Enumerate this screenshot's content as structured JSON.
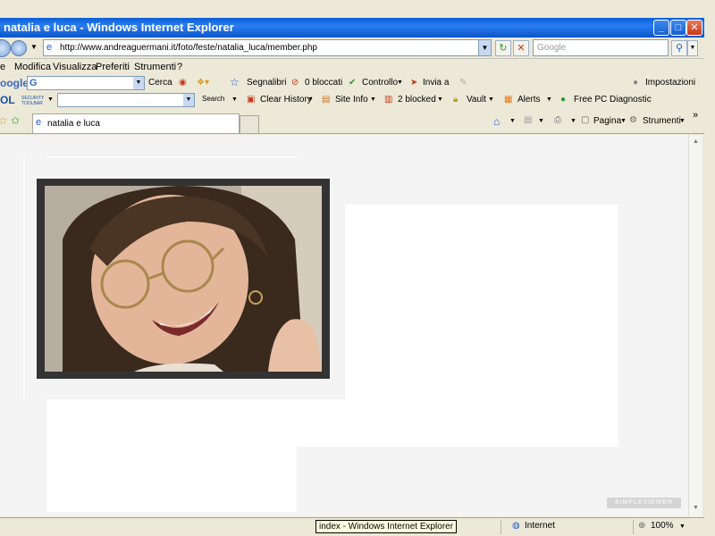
{
  "window": {
    "title": "natalia e luca - Windows Internet Explorer",
    "minimize": "_",
    "maximize": "□",
    "close": "✕"
  },
  "address": {
    "url": "http://www.andreaguermani.it/foto/feste/natalia_luca/member.php",
    "search_placeholder": "Google",
    "go_icon": "refresh-icon",
    "stop_icon": "stop-icon"
  },
  "menu": [
    "e",
    "Modifica",
    "Visualizza",
    "Preferiti",
    "Strumenti",
    "?"
  ],
  "google_toolbar": {
    "logo": "oogle",
    "search_box_logo": "G",
    "search_label": "Cerca",
    "bookmarks": "Segnalibri",
    "blocked": "0 bloccati",
    "spellcheck": "Controllo",
    "send": "Invia a",
    "settings": "Impostazioni"
  },
  "aol_toolbar": {
    "logo": "OL",
    "security": "SECURITY TOOLBAR",
    "search": "Search",
    "clear_history": "Clear History",
    "site_info": "Site Info",
    "blocked": "2 blocked",
    "vault": "Vault",
    "alerts": "Alerts",
    "diagnostic": "Free PC Diagnostic"
  },
  "tabs": {
    "active": "natalia e luca",
    "page": "Pagina",
    "tools": "Strumenti",
    "overflow": "»"
  },
  "content": {
    "watermark": "SIMPLEVIEWER"
  },
  "status": {
    "tooltip": "index - Windows Internet Explorer",
    "zone": "Internet",
    "zoom": "100%"
  }
}
